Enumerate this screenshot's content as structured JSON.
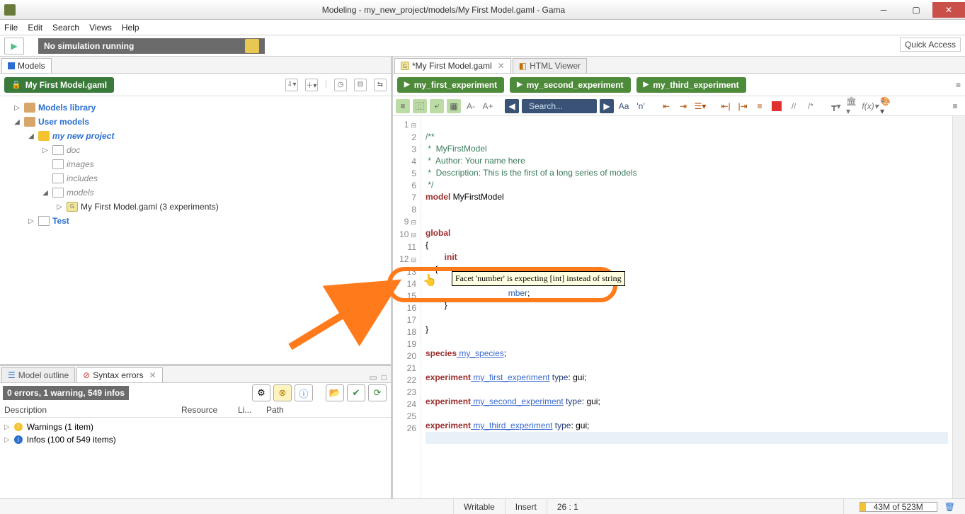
{
  "title": "Modeling - my_new_project/models/My First Model.gaml - Gama",
  "menu": {
    "file": "File",
    "edit": "Edit",
    "search": "Search",
    "views": "Views",
    "help": "Help"
  },
  "sim_status": "No simulation running",
  "quick_access": "Quick Access",
  "models_tab": "Models",
  "current_file_pill": "My First Model.gaml",
  "tree": {
    "lib": "Models library",
    "user": "User models",
    "proj": "my new project",
    "doc": "doc",
    "images": "images",
    "includes": "includes",
    "models": "models",
    "gaml": "My First Model.gaml (3 experiments)",
    "test": "Test"
  },
  "outline_tab": "Model outline",
  "errors_tab": "Syntax errors",
  "errors_status": "0 errors, 1 warning, 549 infos",
  "err_cols": {
    "desc": "Description",
    "res": "Resource",
    "li": "Li...",
    "path": "Path"
  },
  "warnings_item": "Warnings (1 item)",
  "infos_item": "Infos (100 of 549 items)",
  "editor_tab": "*My First Model.gaml",
  "html_tab": "HTML Viewer",
  "experiments": {
    "e1": "my_first_experiment",
    "e2": "my_second_experiment",
    "e3": "my_third_experiment"
  },
  "search_placeholder": "Search...",
  "tooltip": "Facet 'number' is expecting [int] instead of string",
  "code": {
    "l1": "/**",
    "l2": " *  MyFirstModel",
    "l3": " *  Author: Your name here",
    "l4": " *  Description: This is the first of a long series of models",
    "l5": " */",
    "l6a": "model",
    "l6b": " MyFirstModel",
    "l9": "global",
    "l10": "{",
    "l11": "    init",
    "l12": "    {",
    "l14_tail": "mber",
    "l15": "        }",
    "l17": "}",
    "l19a": "species",
    "l19b": " my_species",
    "l21a": "experiment",
    "l21b": " my_first_experiment",
    "l21c": " type",
    "l21d": ": gui;",
    "l23a": "experiment",
    "l23b": " my_second_experiment",
    "l23c": " type",
    "l23d": ": gui;",
    "l25a": "experiment",
    "l25b": " my_third_experiment",
    "l25c": " type",
    "l25d": ": gui;"
  },
  "status": {
    "writable": "Writable",
    "insert": "Insert",
    "pos": "26 : 1",
    "mem": "43M of 523M"
  }
}
